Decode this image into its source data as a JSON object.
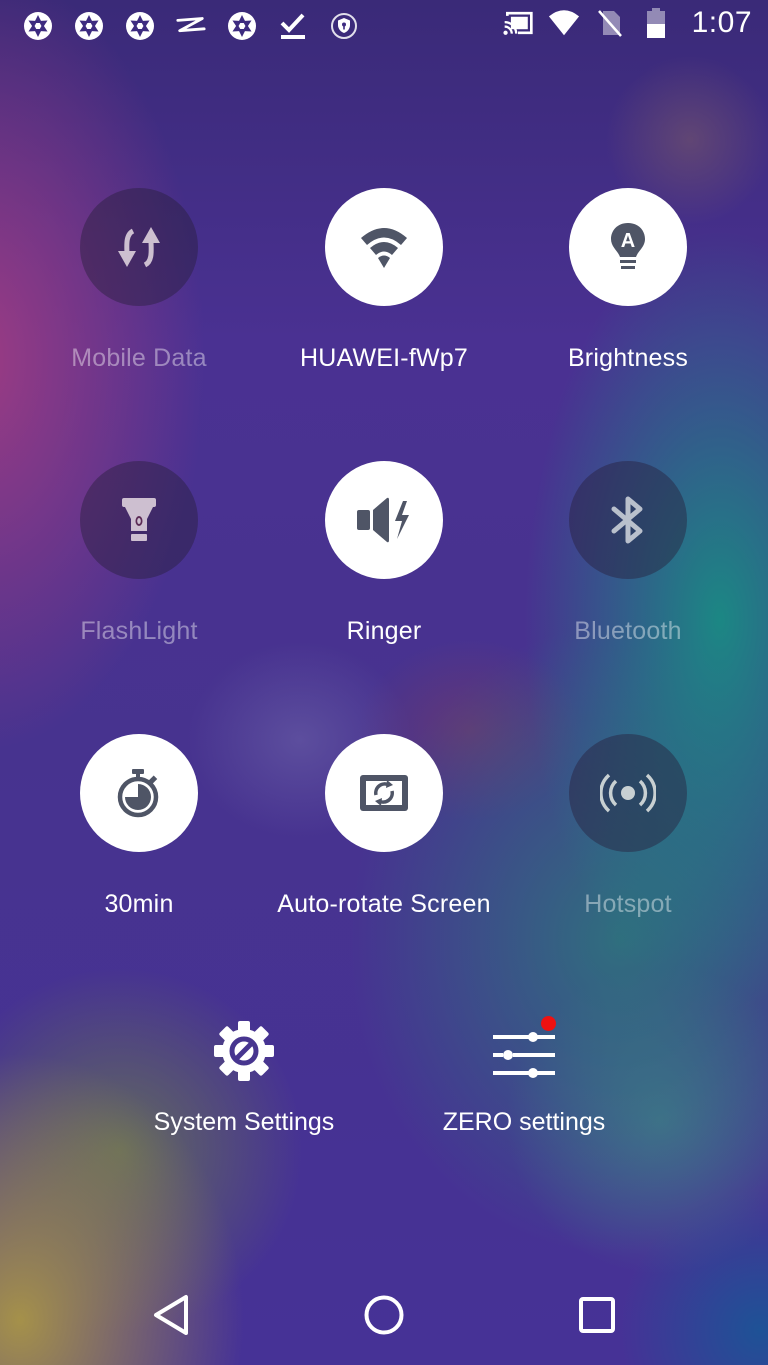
{
  "status_bar": {
    "left_icons": [
      "camera-aperture-icon",
      "camera-aperture-icon",
      "camera-aperture-icon",
      "signature-icon",
      "camera-aperture-icon",
      "download-done-icon",
      "shield-key-icon"
    ],
    "right_icons": [
      "cast-icon",
      "wifi-icon",
      "no-sim-icon",
      "battery-icon"
    ],
    "time": "1:07"
  },
  "tiles": [
    {
      "id": "mobile-data",
      "label": "Mobile Data",
      "icon": "swap-vertical-icon",
      "active": false
    },
    {
      "id": "wifi",
      "label": "HUAWEI-fWp7",
      "icon": "wifi-icon",
      "active": true
    },
    {
      "id": "brightness",
      "label": "Brightness",
      "icon": "auto-brightness-bulb-icon",
      "active": true
    },
    {
      "id": "flashlight",
      "label": "FlashLight",
      "icon": "flashlight-icon",
      "active": false
    },
    {
      "id": "ringer",
      "label": "Ringer",
      "icon": "speaker-vibrate-icon",
      "active": true
    },
    {
      "id": "bluetooth",
      "label": "Bluetooth",
      "icon": "bluetooth-icon",
      "active": false
    },
    {
      "id": "screen-timeout",
      "label": "30min",
      "icon": "stopwatch-icon",
      "active": true
    },
    {
      "id": "auto-rotate",
      "label": "Auto-rotate Screen",
      "icon": "screen-rotation-icon",
      "active": true
    },
    {
      "id": "hotspot",
      "label": "Hotspot",
      "icon": "hotspot-icon",
      "active": false
    }
  ],
  "actions": {
    "system_settings": {
      "label": "System Settings",
      "icon": "gear-icon"
    },
    "zero_settings": {
      "label": "ZERO settings",
      "icon": "sliders-icon",
      "has_notification": true
    }
  },
  "navbar": {
    "back": "back-icon",
    "home": "home-icon",
    "recents": "recents-icon"
  },
  "colors": {
    "icon_dark": "#4f5566",
    "notification_badge": "#ee1111",
    "tile_on": "#ffffff"
  }
}
